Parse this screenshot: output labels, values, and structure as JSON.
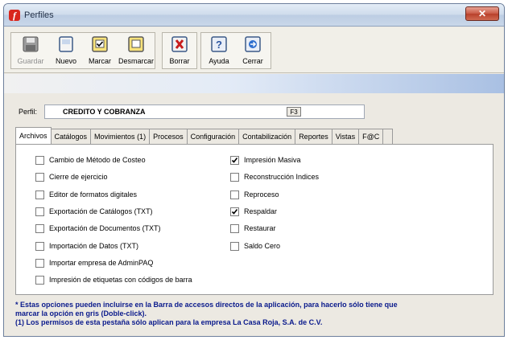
{
  "window": {
    "title": "Perfiles",
    "close_glyph": "✕"
  },
  "toolbar": {
    "buttons": [
      {
        "label": "Guardar",
        "icon": "save-icon",
        "enabled": false
      },
      {
        "label": "Nuevo",
        "icon": "new-icon",
        "enabled": true
      },
      {
        "label": "Marcar",
        "icon": "check-icon",
        "enabled": true
      },
      {
        "label": "Desmarcar",
        "icon": "uncheck-icon",
        "enabled": true
      },
      {
        "label": "Borrar",
        "icon": "delete-icon",
        "enabled": true
      },
      {
        "label": "Ayuda",
        "icon": "help-icon",
        "enabled": true
      },
      {
        "label": "Cerrar",
        "icon": "exit-icon",
        "enabled": true
      }
    ]
  },
  "perfil": {
    "label": "Perfil:",
    "value": "CREDITO Y COBRANZA",
    "hotkey": "F3"
  },
  "tabs": [
    "Archivos",
    "Catálogos",
    "Movimientos (1)",
    "Procesos",
    "Configuración",
    "Contabilización",
    "Reportes",
    "Vistas",
    "F@C"
  ],
  "active_tab": "Archivos",
  "options_left": [
    {
      "label": "Cambio de Método de Costeo",
      "checked": false
    },
    {
      "label": "Cierre de ejercicio",
      "checked": false
    },
    {
      "label": "Editor de formatos digitales",
      "checked": false
    },
    {
      "label": "Exportación de Catálogos (TXT)",
      "checked": false
    },
    {
      "label": "Exportación de Documentos (TXT)",
      "checked": false
    },
    {
      "label": "Importación de Datos (TXT)",
      "checked": false
    },
    {
      "label": "Importar empresa de AdminPAQ",
      "checked": false
    },
    {
      "label": "Impresión de etiquetas con códigos de barra",
      "checked": false
    }
  ],
  "options_right": [
    {
      "label": "Impresión Masiva",
      "checked": true
    },
    {
      "label": "Reconstrucción Indices",
      "checked": false
    },
    {
      "label": "Reproceso",
      "checked": false
    },
    {
      "label": "Respaldar",
      "checked": true
    },
    {
      "label": "Restaurar",
      "checked": false
    },
    {
      "label": "Saldo Cero",
      "checked": false
    }
  ],
  "footnote": {
    "line1": "* Estas opciones pueden incluirse en la Barra de accesos directos de la aplicación, para hacerlo sólo tiene que",
    "line2": "marcar la opción en gris (Doble-click).",
    "line3": "(1) Los permisos de esta pestaña sólo aplican para la empresa La Casa Roja, S.A. de C.V."
  },
  "colors": {
    "footnote": "#0a1a8c",
    "accent_blue": "#a9c0e3",
    "close_red": "#c95a45"
  }
}
